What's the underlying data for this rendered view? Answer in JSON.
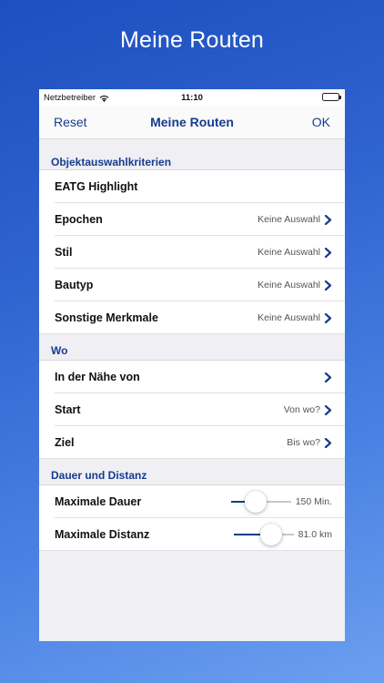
{
  "hero": {
    "title": "Meine Routen"
  },
  "status_bar": {
    "carrier": "Netzbetreiber",
    "time": "11:10"
  },
  "nav": {
    "left": "Reset",
    "title": "Meine Routen",
    "right": "OK"
  },
  "colors": {
    "accent": "#163c8f",
    "background_top": "#1d4fc0",
    "background_bottom": "#6c9ff0"
  },
  "sections": [
    {
      "header": "Objektauswahlkriterien",
      "rows": [
        {
          "label": "EATG Highlight",
          "value": "",
          "chevron": false
        },
        {
          "label": "Epochen",
          "value": "Keine Auswahl",
          "chevron": true
        },
        {
          "label": "Stil",
          "value": "Keine Auswahl",
          "chevron": true
        },
        {
          "label": "Bautyp",
          "value": "Keine Auswahl",
          "chevron": true
        },
        {
          "label": "Sonstige Merkmale",
          "value": "Keine Auswahl",
          "chevron": true
        }
      ]
    },
    {
      "header": "Wo",
      "rows": [
        {
          "label": "In der Nähe von",
          "value": "",
          "chevron": true
        },
        {
          "label": "Start",
          "value": "Von wo?",
          "chevron": true
        },
        {
          "label": "Ziel",
          "value": "Bis wo?",
          "chevron": true
        }
      ]
    },
    {
      "header": "Dauer und Distanz",
      "sliders": [
        {
          "label": "Maximale Dauer",
          "readout": "150 Min.",
          "fraction": 0.42
        },
        {
          "label": "Maximale Distanz",
          "readout": "81.0 km",
          "fraction": 0.62
        }
      ]
    }
  ]
}
